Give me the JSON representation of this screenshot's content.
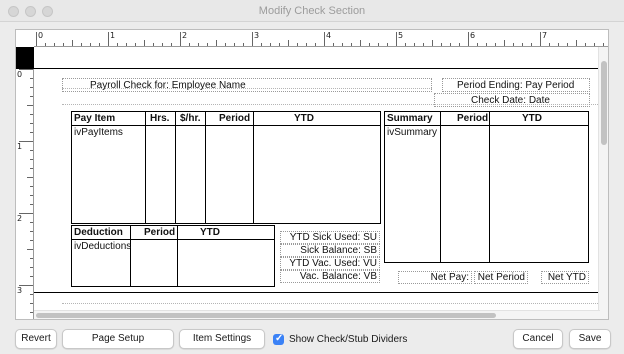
{
  "window": {
    "title": "Modify Check Section"
  },
  "ruler": {
    "top_numbers": [
      "0",
      "1",
      "2",
      "3",
      "4",
      "5",
      "6",
      "7"
    ],
    "left_numbers": [
      "0",
      "1",
      "2",
      "3"
    ]
  },
  "header": {
    "payroll_label": "Payroll Check for:",
    "employee_name": "Employee Name",
    "period_ending_label": "Period Ending:",
    "period_ending_value": "Pay Period",
    "check_date_label": "Check Date:",
    "check_date_value": "Date"
  },
  "pay_table": {
    "columns": [
      "Pay Item",
      "Hrs.",
      "$/hr.",
      "Period",
      "YTD"
    ],
    "item": "ivPayItems"
  },
  "summary_table": {
    "columns": [
      "Summary",
      "Period",
      "YTD"
    ],
    "item": "ivSummary"
  },
  "deduction_table": {
    "columns": [
      "Deduction",
      "Period",
      "YTD"
    ],
    "item": "ivDeductions"
  },
  "ytd_fields": [
    {
      "label": "YTD Sick Used:",
      "value": "SU"
    },
    {
      "label": "Sick Balance:",
      "value": "SB"
    },
    {
      "label": "YTD Vac. Used:",
      "value": "VU"
    },
    {
      "label": "Vac. Balance:",
      "value": "VB"
    }
  ],
  "net": {
    "label": "Net Pay:",
    "period": "Net Period",
    "ytd": "Net YTD"
  },
  "buttons": {
    "revert": "Revert",
    "page_setup": "Page Setup",
    "item_settings": "Item Settings",
    "show_dividers": "Show Check/Stub Dividers",
    "show_dividers_checked": true,
    "cancel": "Cancel",
    "save": "Save"
  }
}
